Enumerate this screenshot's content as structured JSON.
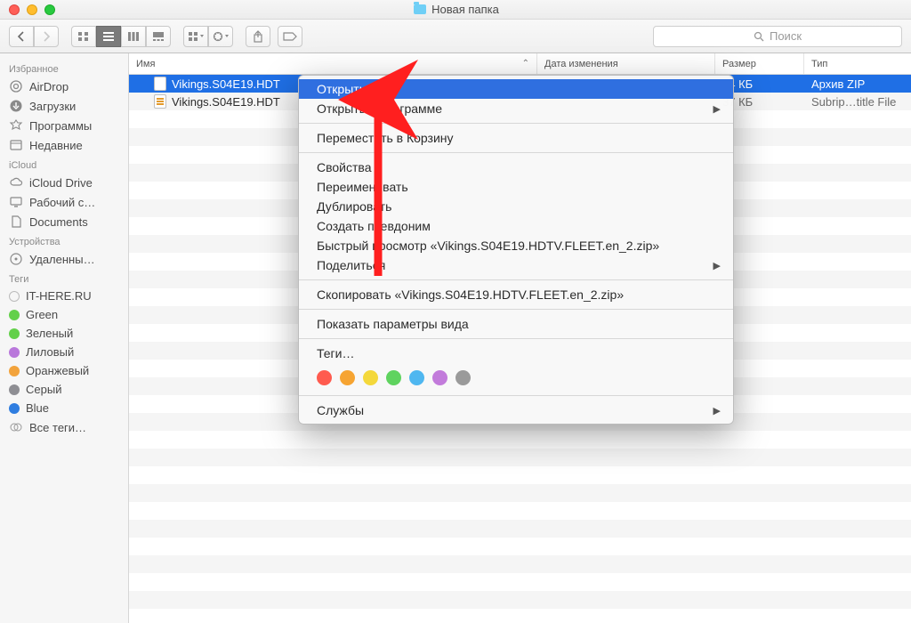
{
  "window": {
    "title": "Новая папка"
  },
  "toolbar": {
    "search_placeholder": "Поиск"
  },
  "sidebar": {
    "sections": [
      {
        "header": "Избранное",
        "items": [
          {
            "label": "AirDrop",
            "icon": "airdrop"
          },
          {
            "label": "Загрузки",
            "icon": "downloads"
          },
          {
            "label": "Программы",
            "icon": "apps"
          },
          {
            "label": "Недавние",
            "icon": "recents"
          }
        ]
      },
      {
        "header": "iCloud",
        "items": [
          {
            "label": "iCloud Drive",
            "icon": "cloud"
          },
          {
            "label": "Рабочий с…",
            "icon": "desktop"
          },
          {
            "label": "Documents",
            "icon": "documents"
          }
        ]
      },
      {
        "header": "Устройства",
        "items": [
          {
            "label": "Удаленны…",
            "icon": "disc"
          }
        ]
      },
      {
        "header": "Теги",
        "items": [
          {
            "label": "IT-HERE.RU",
            "color": ""
          },
          {
            "label": "Green",
            "color": "#63d04a"
          },
          {
            "label": "Зеленый",
            "color": "#63d04a"
          },
          {
            "label": "Лиловый",
            "color": "#b978db"
          },
          {
            "label": "Оранжевый",
            "color": "#f2a33c"
          },
          {
            "label": "Серый",
            "color": "#8e8e93"
          },
          {
            "label": "Blue",
            "color": "#2f7de0"
          },
          {
            "label": "Все теги…",
            "color": ""
          }
        ]
      }
    ]
  },
  "columns": {
    "name": "Имя",
    "date": "Дата изменения",
    "size": "Размер",
    "kind": "Тип"
  },
  "rows": [
    {
      "name": "Vikings.S04E19.HDT",
      "size": "14 КБ",
      "kind": "Архив ZIP",
      "selected": true,
      "icon": "zip"
    },
    {
      "name": "Vikings.S04E19.HDT",
      "size": "37 КБ",
      "kind": "Subrip…title File",
      "selected": false,
      "icon": "srt"
    }
  ],
  "ctx": {
    "open": "Открыть",
    "open_with": "Открыть в программе",
    "trash": "Переместить в Корзину",
    "info": "Свойства",
    "rename": "Переименовать",
    "duplicate": "Дублировать",
    "alias": "Создать псевдоним",
    "quicklook": "Быстрый просмотр «Vikings.S04E19.HDTV.FLEET.en_2.zip»",
    "share": "Поделиться",
    "copy": "Скопировать «Vikings.S04E19.HDTV.FLEET.en_2.zip»",
    "viewopts": "Показать параметры вида",
    "tags_label": "Теги…",
    "services": "Службы",
    "tag_colors": [
      "#ff5b4f",
      "#f6a432",
      "#f4d83b",
      "#5fd35f",
      "#4fb7f0",
      "#c27bdb",
      "#9a9a9a"
    ]
  }
}
